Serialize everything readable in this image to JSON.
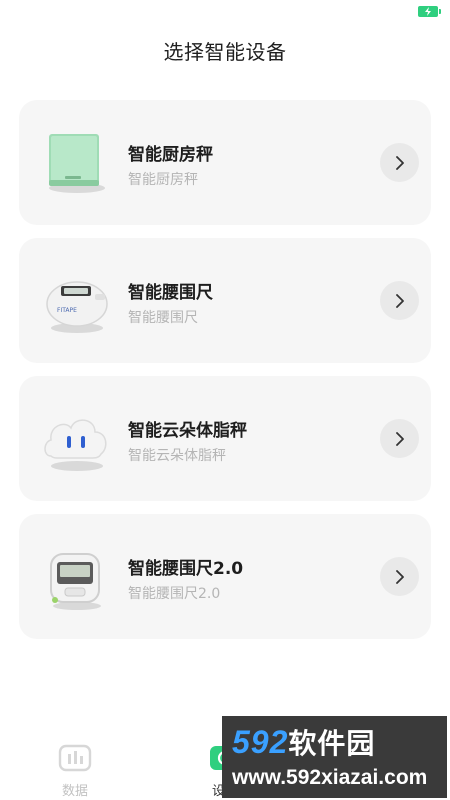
{
  "page": {
    "title": "选择智能设备"
  },
  "devices": [
    {
      "name": "智能厨房秤",
      "subtitle": "智能厨房秤",
      "icon": "kitchen-scale-icon"
    },
    {
      "name": "智能腰围尺",
      "subtitle": "智能腰围尺",
      "icon": "waist-tape-icon"
    },
    {
      "name": "智能云朵体脂秤",
      "subtitle": "智能云朵体脂秤",
      "icon": "cloud-fat-scale-icon"
    },
    {
      "name": "智能腰围尺2.0",
      "subtitle": "智能腰围尺2.0",
      "icon": "waist-tape-v2-icon"
    }
  ],
  "tabs": [
    {
      "label": "数据",
      "icon": "data-chart-icon"
    },
    {
      "label": "设备",
      "icon": "device-icon"
    }
  ],
  "watermark": {
    "brand_num": "592",
    "brand_cn": "软件园",
    "url": "www.592xiazai.com"
  },
  "colors": {
    "accent_green": "#2fcf7f",
    "card_bg": "#f6f6f6",
    "muted_text": "#b5b5b5",
    "watermark_blue": "#3aa0ff"
  }
}
